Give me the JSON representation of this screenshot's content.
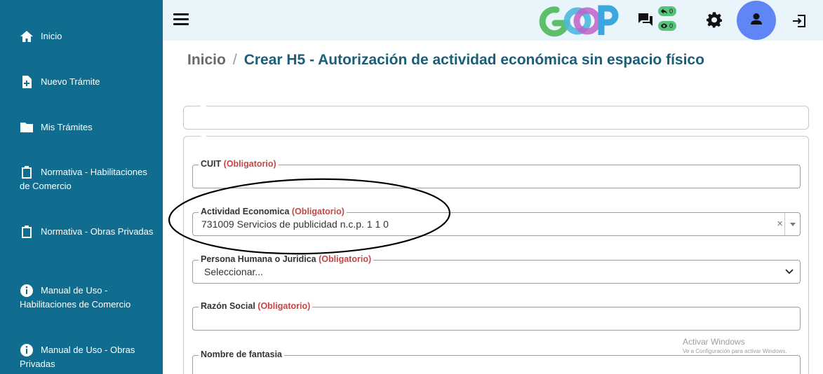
{
  "sidebar": {
    "items": [
      {
        "label": "Inicio",
        "icon": "home-icon"
      },
      {
        "label": "Nuevo Trámite",
        "icon": "file-plus-icon"
      },
      {
        "label": "Mis Trámites",
        "icon": "folder-icon"
      },
      {
        "label": "Normativa - Habilitaciones de Comercio",
        "icon": "clipboard-icon"
      },
      {
        "label": "Normativa - Obras Privadas",
        "icon": "clipboard-icon"
      },
      {
        "label": "Manual de Uso - Habilitaciones de Comercio",
        "icon": "info-circle-icon"
      },
      {
        "label": "Manual de Uso - Obras Privadas",
        "icon": "info-circle-icon"
      }
    ]
  },
  "topbar": {
    "messages_replied_count": "0",
    "messages_seen_count": "0"
  },
  "breadcrumb": {
    "home": "Inicio",
    "separator": "/",
    "current": "Crear H5 - Autorización de actividad económica sin espacio físico"
  },
  "form": {
    "cuit": {
      "label": "CUIT",
      "required": "(Obligatorio)",
      "value": ""
    },
    "actividad": {
      "label": "Actividad Economica",
      "required": "(Obligatorio)",
      "value": "731009 Servicios de publicidad n.c.p. 1 1 0"
    },
    "persona": {
      "label": "Persona Humana o Juridica",
      "required": "(Obligatorio)",
      "value": "Seleccionar..."
    },
    "razon_social": {
      "label": "Razón Social",
      "required": "(Obligatorio)",
      "value": ""
    },
    "nombre_fantasia": {
      "label": "Nombre de fantasia",
      "value": ""
    }
  },
  "watermark": {
    "title": "Activar Windows",
    "subtitle": "Ve a Configuración para activar Windows."
  },
  "colors": {
    "sidebar": "#106d8f",
    "topbar": "#e9f4fb",
    "breadcrumb_current": "#1a5e7a",
    "required_text": "#c64545",
    "avatar": "#5f86f4",
    "badge": "#59c27a"
  }
}
